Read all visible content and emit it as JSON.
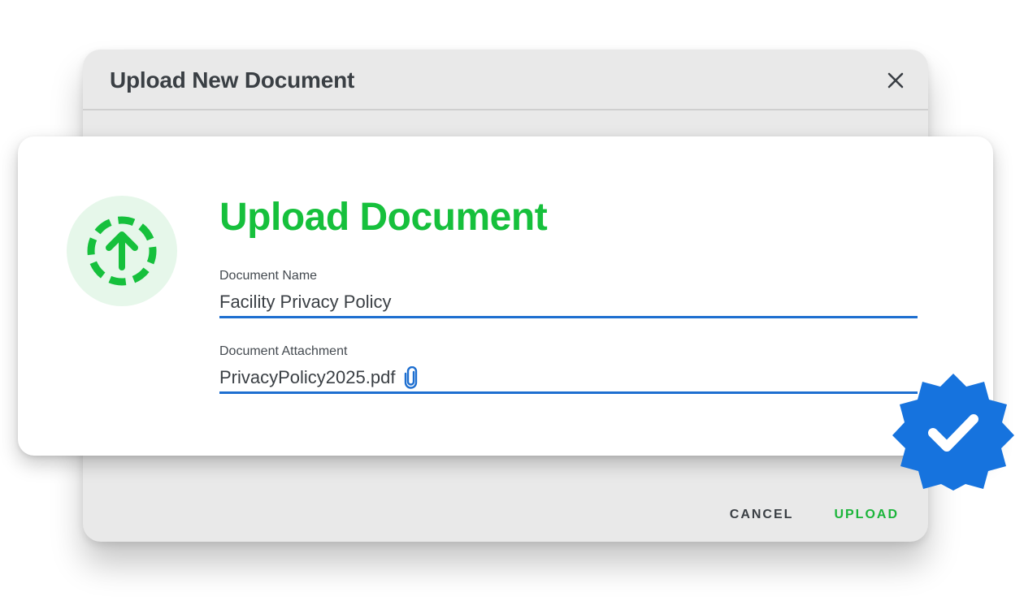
{
  "dialog": {
    "title": "Upload New Document",
    "close_icon": "close-icon",
    "actions": {
      "cancel_label": "CANCEL",
      "upload_label": "UPLOAD"
    }
  },
  "card": {
    "icon": "upload-arrow-icon",
    "title": "Upload Document",
    "fields": {
      "name": {
        "label": "Document Name",
        "value": "Facility Privacy Policy"
      },
      "attachment": {
        "label": "Document Attachment",
        "value": "PrivacyPolicy2025.pdf",
        "icon": "paperclip-icon"
      }
    }
  },
  "badge": {
    "icon": "verified-check-icon"
  },
  "colors": {
    "accent_green": "#16c03c",
    "accent_blue": "#1e6fd0",
    "badge_blue": "#1673de",
    "icon_bg_green": "#e6f7ea",
    "dialog_bg": "#e9e9e9"
  }
}
